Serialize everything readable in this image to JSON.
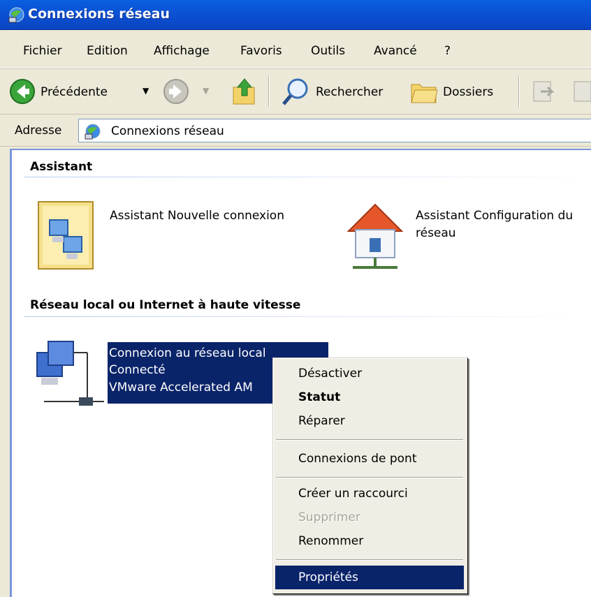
{
  "window": {
    "title": "Connexions réseau",
    "accent": "#0b4fd1"
  },
  "menubar": {
    "items": [
      "Fichier",
      "Edition",
      "Affichage",
      "Favoris",
      "Outils",
      "Avancé",
      "?"
    ]
  },
  "toolbar": {
    "back_label": "Précédente",
    "search_label": "Rechercher",
    "folders_label": "Dossiers",
    "icons": [
      "back-arrow-icon",
      "forward-arrow-icon",
      "folder-up-icon",
      "magnifier-icon",
      "folders-icon",
      "move-to-icon",
      "copy-to-icon"
    ]
  },
  "address": {
    "label": "Adresse",
    "value": "Connexions réseau"
  },
  "content": {
    "group1": {
      "header": "Assistant",
      "items": [
        {
          "label": "Assistant Nouvelle connexion",
          "icon": "new-connection-wizard-icon"
        },
        {
          "label_line1": "Assistant Configuration du",
          "label_line2": "réseau",
          "icon": "network-setup-house-icon"
        }
      ]
    },
    "group2": {
      "header": "Réseau local ou Internet à haute vitesse",
      "connection": {
        "name": "Connexion au réseau local",
        "status": "Connecté",
        "device": "VMware Accelerated AM",
        "icon": "lan-connection-icon",
        "selected_color": "#0a246a"
      }
    }
  },
  "context_menu": {
    "items": [
      {
        "label": "Désactiver"
      },
      {
        "label": "Statut",
        "default": true
      },
      {
        "label": "Réparer"
      },
      {
        "label": "Connexions de pont"
      },
      {
        "label": "Créer un raccourci"
      },
      {
        "label": "Supprimer",
        "disabled": true
      },
      {
        "label": "Renommer"
      },
      {
        "label": "Propriétés",
        "highlighted": true
      }
    ]
  }
}
